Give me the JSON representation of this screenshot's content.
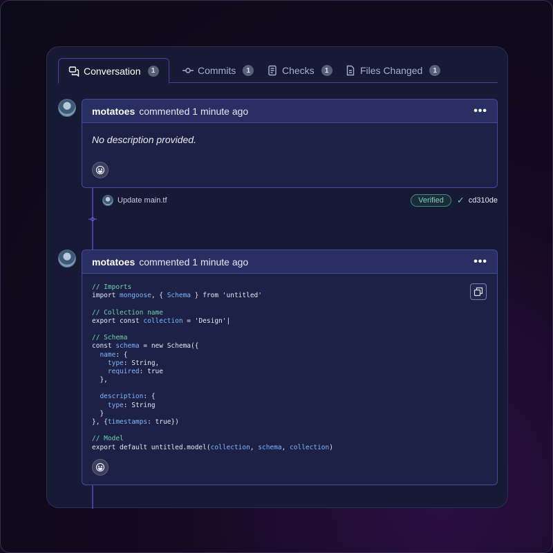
{
  "tabs": [
    {
      "label": "Conversation",
      "count": "1",
      "icon": "conversation-icon"
    },
    {
      "label": "Commits",
      "count": "1",
      "icon": "commit-icon"
    },
    {
      "label": "Checks",
      "count": "1",
      "icon": "checks-icon"
    },
    {
      "label": "Files Changed",
      "count": "1",
      "icon": "file-icon"
    }
  ],
  "comment1": {
    "author": "motatoes",
    "meta": "commented 1 minute ago",
    "more": "•••",
    "body": "No description provided."
  },
  "commit": {
    "message": "Update main.tf",
    "verified": "Verified",
    "sha": "cd310de"
  },
  "comment2": {
    "author": "motatoes",
    "meta": "commented 1 minute ago",
    "more": "•••",
    "code": [
      [
        {
          "t": "// Imports",
          "k": "c"
        }
      ],
      [
        {
          "t": "import "
        },
        {
          "t": "mongoose",
          "k": "v"
        },
        {
          "t": ", { "
        },
        {
          "t": "Schema",
          "k": "v"
        },
        {
          "t": " } from 'untitled'"
        }
      ],
      [],
      [
        {
          "t": "// Collection name",
          "k": "c"
        }
      ],
      [
        {
          "t": "export const "
        },
        {
          "t": "collection",
          "k": "v"
        },
        {
          "t": " = 'Design'|"
        }
      ],
      [],
      [
        {
          "t": "// Schema",
          "k": "c"
        }
      ],
      [
        {
          "t": "const "
        },
        {
          "t": "schema",
          "k": "v"
        },
        {
          "t": " = new Schema({"
        }
      ],
      [
        {
          "t": "  "
        },
        {
          "t": "name",
          "k": "v"
        },
        {
          "t": ": {"
        }
      ],
      [
        {
          "t": "    "
        },
        {
          "t": "type",
          "k": "v"
        },
        {
          "t": ": String,"
        }
      ],
      [
        {
          "t": "    "
        },
        {
          "t": "required",
          "k": "v"
        },
        {
          "t": ": true"
        }
      ],
      [
        {
          "t": "  },"
        }
      ],
      [],
      [
        {
          "t": "  "
        },
        {
          "t": "description",
          "k": "v"
        },
        {
          "t": ": {"
        }
      ],
      [
        {
          "t": "    "
        },
        {
          "t": "type",
          "k": "v"
        },
        {
          "t": ": String"
        }
      ],
      [
        {
          "t": "  }"
        }
      ],
      [
        {
          "t": "}, {"
        },
        {
          "t": "timestamps",
          "k": "v"
        },
        {
          "t": ": true})"
        }
      ],
      [],
      [
        {
          "t": "// Model",
          "k": "c"
        }
      ],
      [
        {
          "t": "export default untitled.model("
        },
        {
          "t": "collection",
          "k": "v"
        },
        {
          "t": ", "
        },
        {
          "t": "schema",
          "k": "v"
        },
        {
          "t": ", "
        },
        {
          "t": "collection",
          "k": "v"
        },
        {
          "t": ")"
        }
      ]
    ]
  },
  "colors": {
    "accent": "#4b3fa6",
    "card_header": "#2a2f63",
    "verified": "#7fd3b3",
    "code_comment": "#6fd3b0",
    "code_identifier": "#7fb6ff"
  }
}
